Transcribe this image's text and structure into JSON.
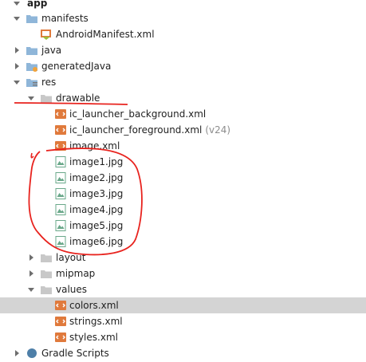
{
  "tree": {
    "app": "app",
    "manifests": "manifests",
    "android_manifest": "AndroidManifest.xml",
    "java": "java",
    "generated_java": "generatedJava",
    "res": "res",
    "drawable": "drawable",
    "ic_launcher_background": "ic_launcher_background.xml",
    "ic_launcher_foreground": "ic_launcher_foreground.xml",
    "ic_launcher_foreground_suffix": "(v24)",
    "image_xml": "image.xml",
    "image1": "image1.jpg",
    "image2": "image2.jpg",
    "image3": "image3.jpg",
    "image4": "image4.jpg",
    "image5": "image5.jpg",
    "image6": "image6.jpg",
    "layout": "layout",
    "mipmap": "mipmap",
    "values": "values",
    "colors": "colors.xml",
    "strings": "strings.xml",
    "styles": "styles.xml",
    "gradle_scripts": "Gradle Scripts"
  },
  "colors": {
    "folder": "#8fb6d9",
    "xml_icon": "#e07a3c",
    "image_icon": "#6aa88a",
    "selection": "#d4d4d4",
    "annotation": "#e8231e"
  }
}
